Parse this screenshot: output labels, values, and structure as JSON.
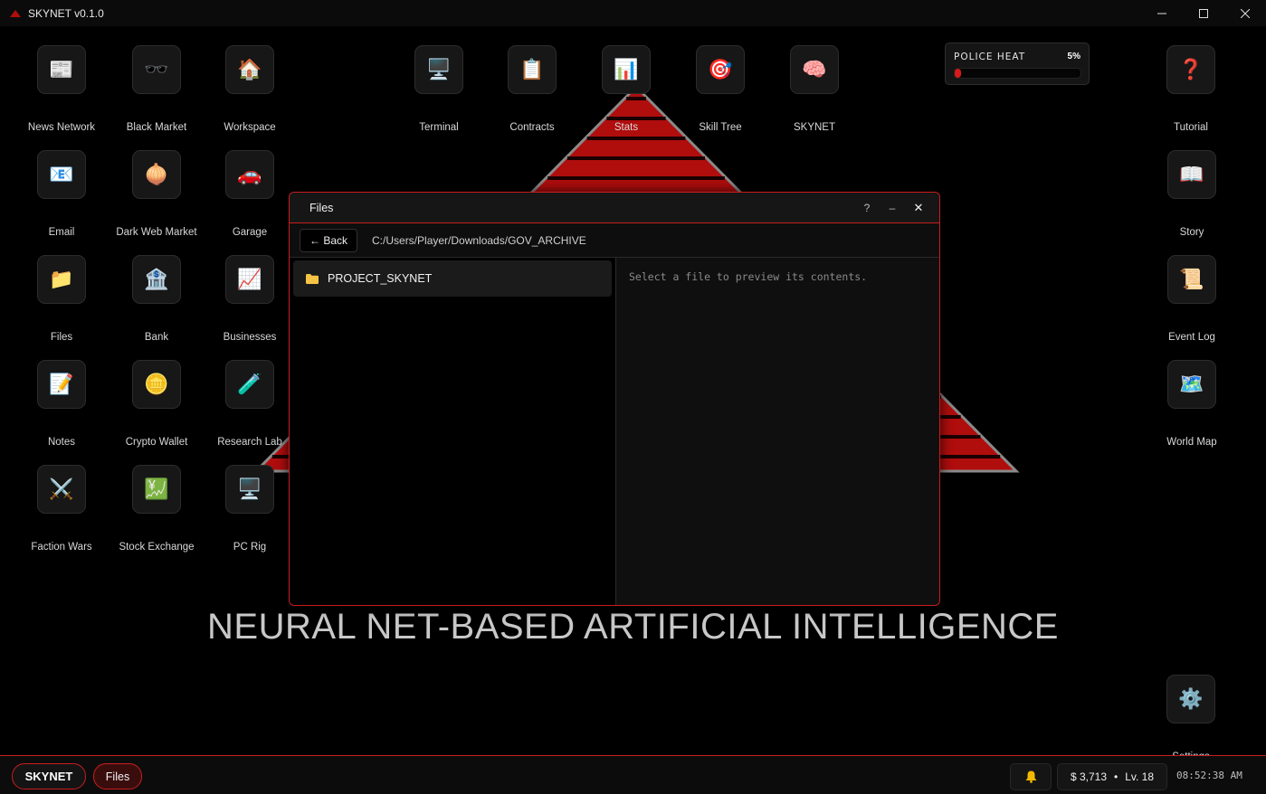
{
  "window": {
    "title": "SKYNET v0.1.0"
  },
  "wallpaper": {
    "tagline": "NEURAL NET-BASED ARTIFICIAL INTELLIGENCE"
  },
  "desktop_icons": [
    {
      "label": "News Network",
      "icon": "newspaper-icon"
    },
    {
      "label": "Black Market",
      "icon": "sunglasses-icon"
    },
    {
      "label": "Workspace",
      "icon": "house-icon"
    },
    {
      "label": "Terminal",
      "icon": "monitor-icon"
    },
    {
      "label": "Contracts",
      "icon": "clipboard-icon"
    },
    {
      "label": "Stats",
      "icon": "bar-chart-icon"
    },
    {
      "label": "Skill Tree",
      "icon": "target-icon"
    },
    {
      "label": "SKYNET",
      "icon": "brain-icon"
    },
    {
      "label": "Tutorial",
      "icon": "question-icon"
    },
    {
      "label": "Email",
      "icon": "email-icon"
    },
    {
      "label": "Dark Web Market",
      "icon": "onion-icon"
    },
    {
      "label": "Garage",
      "icon": "car-icon"
    },
    {
      "label": "Story",
      "icon": "book-icon"
    },
    {
      "label": "Files",
      "icon": "folder-icon"
    },
    {
      "label": "Bank",
      "icon": "bank-icon"
    },
    {
      "label": "Businesses",
      "icon": "trend-chart-icon"
    },
    {
      "label": "Event Log",
      "icon": "scroll-icon"
    },
    {
      "label": "Notes",
      "icon": "memo-icon"
    },
    {
      "label": "Crypto Wallet",
      "icon": "coin-icon"
    },
    {
      "label": "Research Lab",
      "icon": "test-tube-icon"
    },
    {
      "label": "World Map",
      "icon": "map-icon"
    },
    {
      "label": "Faction Wars",
      "icon": "crossed-swords-icon"
    },
    {
      "label": "Stock Exchange",
      "icon": "stock-chart-icon"
    },
    {
      "label": "PC Rig",
      "icon": "computer-icon"
    },
    {
      "label": "Settings",
      "icon": "gear-icon"
    }
  ],
  "police_heat": {
    "label": "POLICE HEAT",
    "value_text": "5%",
    "level": 0.05
  },
  "files_window": {
    "title": "Files",
    "help": "?",
    "minimize": "–",
    "close": "✕",
    "back_label": "← Back",
    "path": "C:/Users/Player/Downloads/GOV_ARCHIVE",
    "items": [
      {
        "name": "PROJECT_SKYNET",
        "icon": "folder-icon"
      }
    ],
    "preview_hint": "Select a file to preview its contents."
  },
  "taskbar": {
    "start_label": "SKYNET",
    "open_tasks": [
      "Files"
    ],
    "money": "$ 3,713",
    "separator": "•",
    "level": "Lv. 18",
    "clock": "08:52:38 AM"
  },
  "colors": {
    "accent": "#c91d1d",
    "background": "#000000",
    "pyramid": "#b00d0d",
    "heat_fill": "#d81a1a"
  }
}
